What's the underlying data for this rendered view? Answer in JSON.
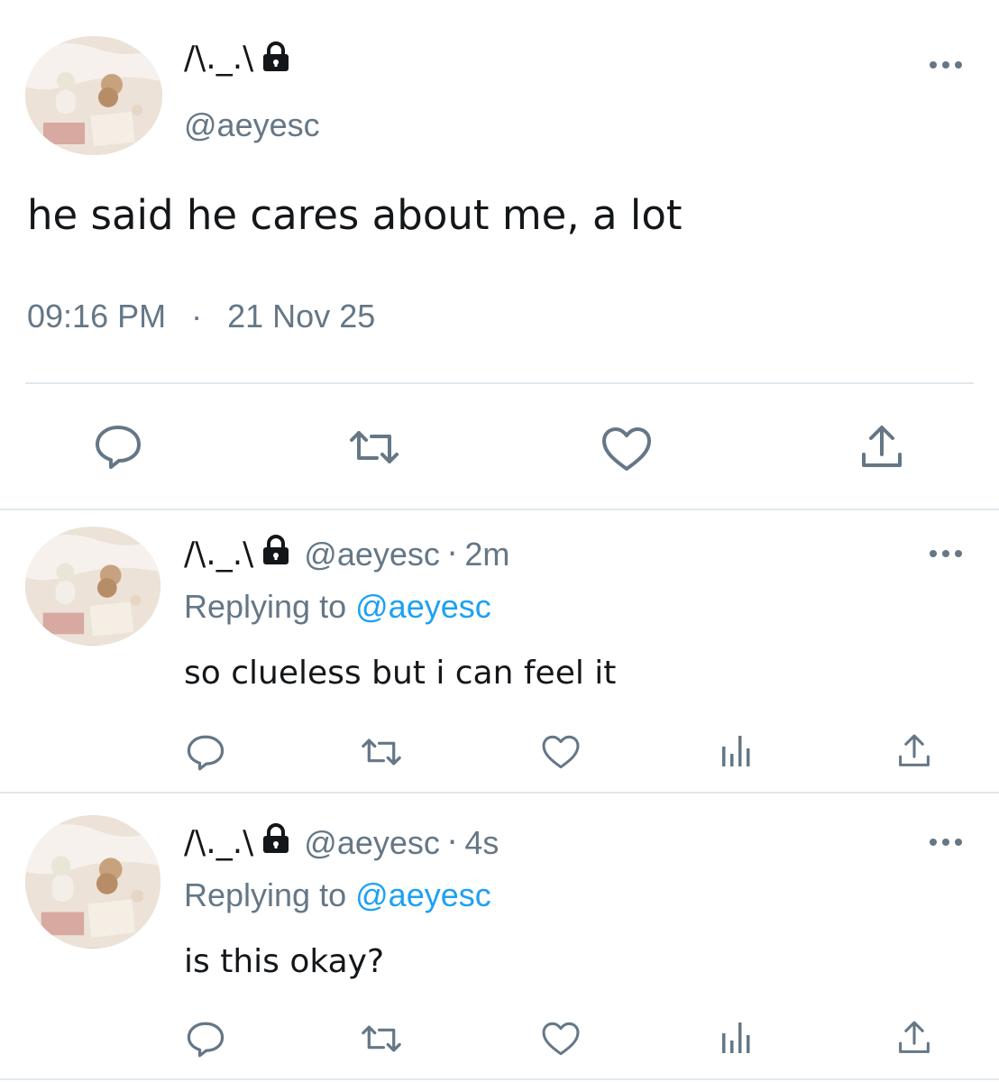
{
  "main_tweet": {
    "display_name": "/\\._.\\",
    "handle": "@aeyesc",
    "text": "he said he cares about me, a lot",
    "time": "09:16 PM",
    "separator": "·",
    "date": "21 Nov 25",
    "actions": [
      "reply-icon",
      "retweet-icon",
      "like-icon",
      "share-icon"
    ]
  },
  "replies": [
    {
      "display_name": "/\\._.\\",
      "handle": "@aeyesc",
      "dot": "·",
      "age": "2m",
      "replying_label": "Replying to",
      "replying_handle": "@aeyesc",
      "text": "so clueless but i can feel it",
      "actions": [
        "reply-icon",
        "retweet-icon",
        "like-icon",
        "analytics-icon",
        "share-icon"
      ]
    },
    {
      "display_name": "/\\._.\\",
      "handle": "@aeyesc",
      "dot": "·",
      "age": "4s",
      "replying_label": "Replying to",
      "replying_handle": "@aeyesc",
      "text": "is this okay?",
      "actions": [
        "reply-icon",
        "retweet-icon",
        "like-icon",
        "analytics-icon",
        "share-icon"
      ]
    }
  ],
  "colors": {
    "text": "#14171a",
    "secondary": "#657786",
    "link": "#1da1f2",
    "divider": "#e1e8ed"
  }
}
